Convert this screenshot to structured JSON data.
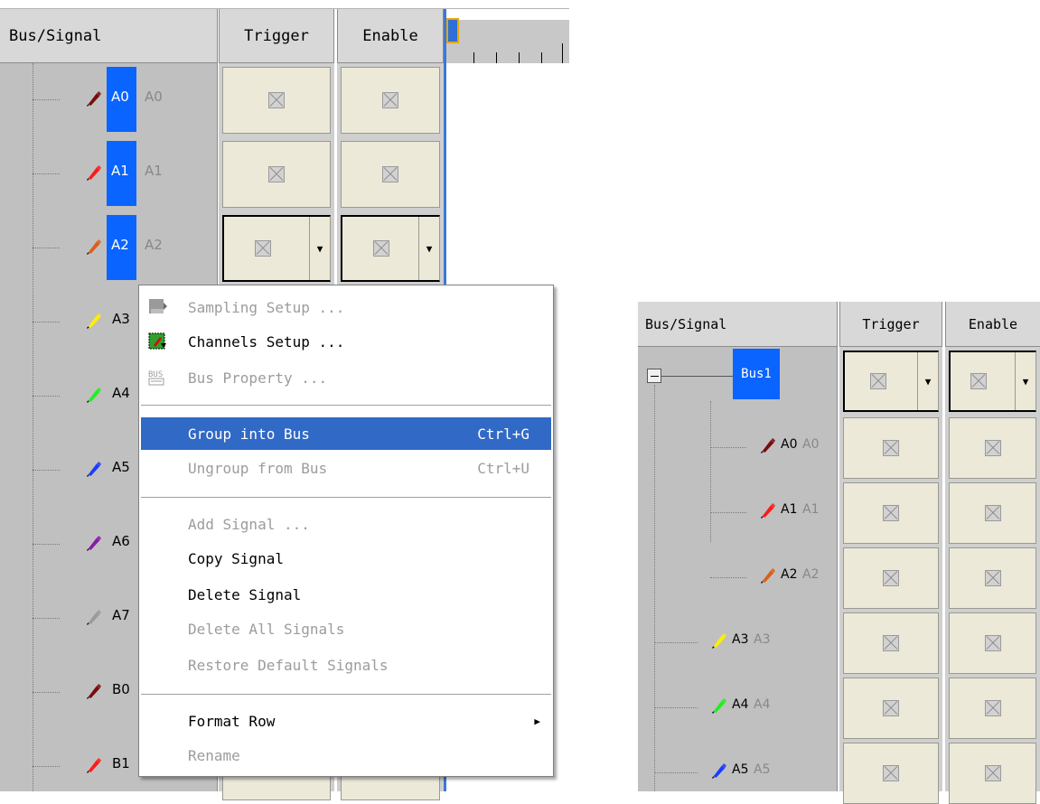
{
  "left_panel": {
    "headers": {
      "signal": "Bus/Signal",
      "trigger": "Trigger",
      "enable": "Enable"
    },
    "signals": [
      {
        "name": "A0",
        "alias": "A0",
        "color": "#7a0c0c",
        "selected": true
      },
      {
        "name": "A1",
        "alias": "A1",
        "color": "#ff1a1a",
        "selected": true
      },
      {
        "name": "A2",
        "alias": "A2",
        "color": "#d8601a",
        "selected": true
      },
      {
        "name": "A3",
        "color": "#ffee00"
      },
      {
        "name": "A4",
        "color": "#22ee22"
      },
      {
        "name": "A5",
        "color": "#1a3cff"
      },
      {
        "name": "A6",
        "color": "#8a1aa8"
      },
      {
        "name": "A7",
        "color": "#9a9a9a"
      },
      {
        "name": "B0",
        "color": "#7a0c0c"
      },
      {
        "name": "B1",
        "color": "#ff1a1a"
      }
    ]
  },
  "context_menu": {
    "items": [
      {
        "label": "Sampling Setup ...",
        "enabled": false,
        "icon": "sampling-icon"
      },
      {
        "label": "Channels Setup ...",
        "enabled": true,
        "icon": "channels-icon"
      },
      {
        "label": "Bus Property ...",
        "enabled": false,
        "icon": "bus-icon",
        "icon_text": "BUS"
      },
      {
        "label": "Group into Bus",
        "shortcut": "Ctrl+G",
        "enabled": true,
        "highlighted": true
      },
      {
        "label": "Ungroup from Bus",
        "shortcut": "Ctrl+U",
        "enabled": false
      },
      {
        "label": "Add Signal ...",
        "enabled": false
      },
      {
        "label": "Copy Signal",
        "enabled": true
      },
      {
        "label": "Delete Signal",
        "enabled": true
      },
      {
        "label": "Delete All Signals",
        "enabled": false
      },
      {
        "label": "Restore Default Signals",
        "enabled": false
      },
      {
        "label": "Format Row",
        "enabled": true,
        "submenu": true
      },
      {
        "label": "Rename",
        "enabled": false
      }
    ]
  },
  "right_panel": {
    "headers": {
      "signal": "Bus/Signal",
      "trigger": "Trigger",
      "enable": "Enable"
    },
    "bus": {
      "name": "Bus1"
    },
    "signals": [
      {
        "name": "A0",
        "alias": "A0",
        "color": "#7a0c0c",
        "in_bus": true
      },
      {
        "name": "A1",
        "alias": "A1",
        "color": "#ff1a1a",
        "in_bus": true
      },
      {
        "name": "A2",
        "alias": "A2",
        "color": "#d8601a",
        "in_bus": true
      },
      {
        "name": "A3",
        "alias": "A3",
        "color": "#ffee00",
        "in_bus": false
      },
      {
        "name": "A4",
        "alias": "A4",
        "color": "#22ee22",
        "in_bus": false
      },
      {
        "name": "A5",
        "alias": "A5",
        "color": "#1a3cff",
        "in_bus": false
      }
    ]
  }
}
